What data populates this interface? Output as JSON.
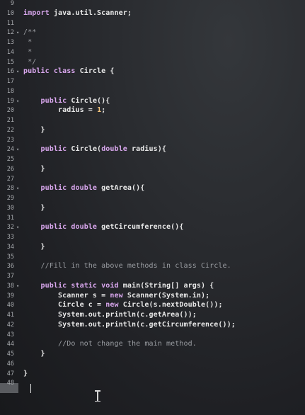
{
  "editor": {
    "lines": [
      {
        "num": "9",
        "fold": "",
        "segments": []
      },
      {
        "num": "10",
        "fold": "",
        "segments": [
          {
            "t": "kw",
            "s": "import"
          },
          {
            "t": "tx",
            "s": " java.util.Scanner;"
          }
        ]
      },
      {
        "num": "11",
        "fold": "",
        "segments": []
      },
      {
        "num": "12",
        "fold": "▾",
        "segments": [
          {
            "t": "cm",
            "s": "/**"
          }
        ]
      },
      {
        "num": "13",
        "fold": "",
        "segments": [
          {
            "t": "cm",
            "s": " *"
          }
        ]
      },
      {
        "num": "14",
        "fold": "",
        "segments": [
          {
            "t": "cm",
            "s": " *"
          }
        ]
      },
      {
        "num": "15",
        "fold": "",
        "segments": [
          {
            "t": "cm",
            "s": " */"
          }
        ]
      },
      {
        "num": "16",
        "fold": "▾",
        "segments": [
          {
            "t": "kw",
            "s": "public class"
          },
          {
            "t": "tx",
            "s": " Circle {"
          }
        ]
      },
      {
        "num": "17",
        "fold": "",
        "segments": []
      },
      {
        "num": "18",
        "fold": "",
        "segments": []
      },
      {
        "num": "19",
        "fold": "▾",
        "segments": [
          {
            "t": "tx",
            "s": "    "
          },
          {
            "t": "kw",
            "s": "public"
          },
          {
            "t": "tx",
            "s": " Circle(){"
          }
        ]
      },
      {
        "num": "20",
        "fold": "",
        "segments": [
          {
            "t": "tx",
            "s": "        radius = "
          },
          {
            "t": "nu",
            "s": "1"
          },
          {
            "t": "tx",
            "s": ";"
          }
        ]
      },
      {
        "num": "21",
        "fold": "",
        "segments": []
      },
      {
        "num": "22",
        "fold": "",
        "segments": [
          {
            "t": "tx",
            "s": "    }"
          }
        ]
      },
      {
        "num": "23",
        "fold": "",
        "segments": []
      },
      {
        "num": "24",
        "fold": "▾",
        "segments": [
          {
            "t": "tx",
            "s": "    "
          },
          {
            "t": "kw",
            "s": "public"
          },
          {
            "t": "tx",
            "s": " Circle("
          },
          {
            "t": "kw",
            "s": "double"
          },
          {
            "t": "tx",
            "s": " radius){"
          }
        ]
      },
      {
        "num": "25",
        "fold": "",
        "segments": []
      },
      {
        "num": "26",
        "fold": "",
        "segments": [
          {
            "t": "tx",
            "s": "    }"
          }
        ]
      },
      {
        "num": "27",
        "fold": "",
        "segments": []
      },
      {
        "num": "28",
        "fold": "▾",
        "segments": [
          {
            "t": "tx",
            "s": "    "
          },
          {
            "t": "kw",
            "s": "public double"
          },
          {
            "t": "tx",
            "s": " getArea(){"
          }
        ]
      },
      {
        "num": "29",
        "fold": "",
        "segments": []
      },
      {
        "num": "30",
        "fold": "",
        "segments": [
          {
            "t": "tx",
            "s": "    }"
          }
        ]
      },
      {
        "num": "31",
        "fold": "",
        "segments": []
      },
      {
        "num": "32",
        "fold": "▾",
        "segments": [
          {
            "t": "tx",
            "s": "    "
          },
          {
            "t": "kw",
            "s": "public double"
          },
          {
            "t": "tx",
            "s": " getCircumference(){"
          }
        ]
      },
      {
        "num": "33",
        "fold": "",
        "segments": []
      },
      {
        "num": "34",
        "fold": "",
        "segments": [
          {
            "t": "tx",
            "s": "    }"
          }
        ]
      },
      {
        "num": "35",
        "fold": "",
        "segments": []
      },
      {
        "num": "36",
        "fold": "",
        "segments": [
          {
            "t": "cm",
            "s": "    //Fill in the above methods in class Circle."
          }
        ]
      },
      {
        "num": "37",
        "fold": "",
        "segments": []
      },
      {
        "num": "38",
        "fold": "▾",
        "segments": [
          {
            "t": "tx",
            "s": "    "
          },
          {
            "t": "kw",
            "s": "public static void"
          },
          {
            "t": "tx",
            "s": " main(String[] args) {"
          }
        ]
      },
      {
        "num": "39",
        "fold": "",
        "segments": [
          {
            "t": "tx",
            "s": "        Scanner s = "
          },
          {
            "t": "kw",
            "s": "new"
          },
          {
            "t": "tx",
            "s": " Scanner(System.in);"
          }
        ]
      },
      {
        "num": "40",
        "fold": "",
        "segments": [
          {
            "t": "tx",
            "s": "        Circle c = "
          },
          {
            "t": "kw",
            "s": "new"
          },
          {
            "t": "tx",
            "s": " Circle(s.nextDouble());"
          }
        ]
      },
      {
        "num": "41",
        "fold": "",
        "segments": [
          {
            "t": "tx",
            "s": "        System.out.println(c.getArea());"
          }
        ]
      },
      {
        "num": "42",
        "fold": "",
        "segments": [
          {
            "t": "tx",
            "s": "        System.out.println(c.getCircumference());"
          }
        ]
      },
      {
        "num": "43",
        "fold": "",
        "segments": []
      },
      {
        "num": "44",
        "fold": "",
        "segments": [
          {
            "t": "cm",
            "s": "        //Do not change the main method."
          }
        ]
      },
      {
        "num": "45",
        "fold": "",
        "segments": [
          {
            "t": "tx",
            "s": "    }"
          }
        ]
      },
      {
        "num": "46",
        "fold": "",
        "segments": []
      },
      {
        "num": "47",
        "fold": "",
        "segments": [
          {
            "t": "tx",
            "s": "}"
          }
        ]
      },
      {
        "num": "48",
        "fold": "",
        "segments": []
      }
    ]
  }
}
